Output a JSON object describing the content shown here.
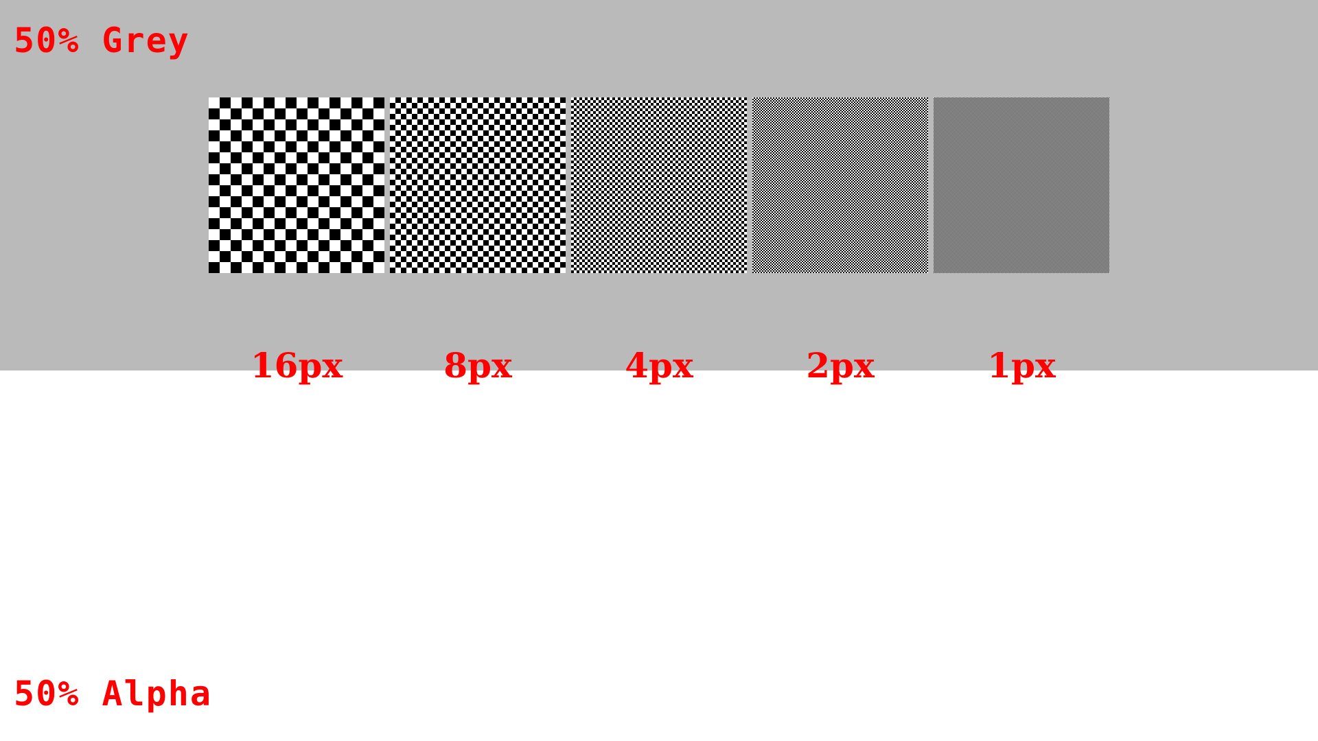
{
  "headings": {
    "grey": "50% Grey",
    "alpha": "50% Alpha"
  },
  "colors": {
    "background_grey": "#bababa",
    "background_lower": "#ffffff",
    "text": "#ff0000",
    "check_dark": "#000000",
    "check_light": "#ffffff"
  },
  "swatches": [
    {
      "label": "16px",
      "cell": 16
    },
    {
      "label": "8px",
      "cell": 8
    },
    {
      "label": "4px",
      "cell": 4
    },
    {
      "label": "2px",
      "cell": 2
    },
    {
      "label": "1px",
      "cell": 1
    }
  ]
}
